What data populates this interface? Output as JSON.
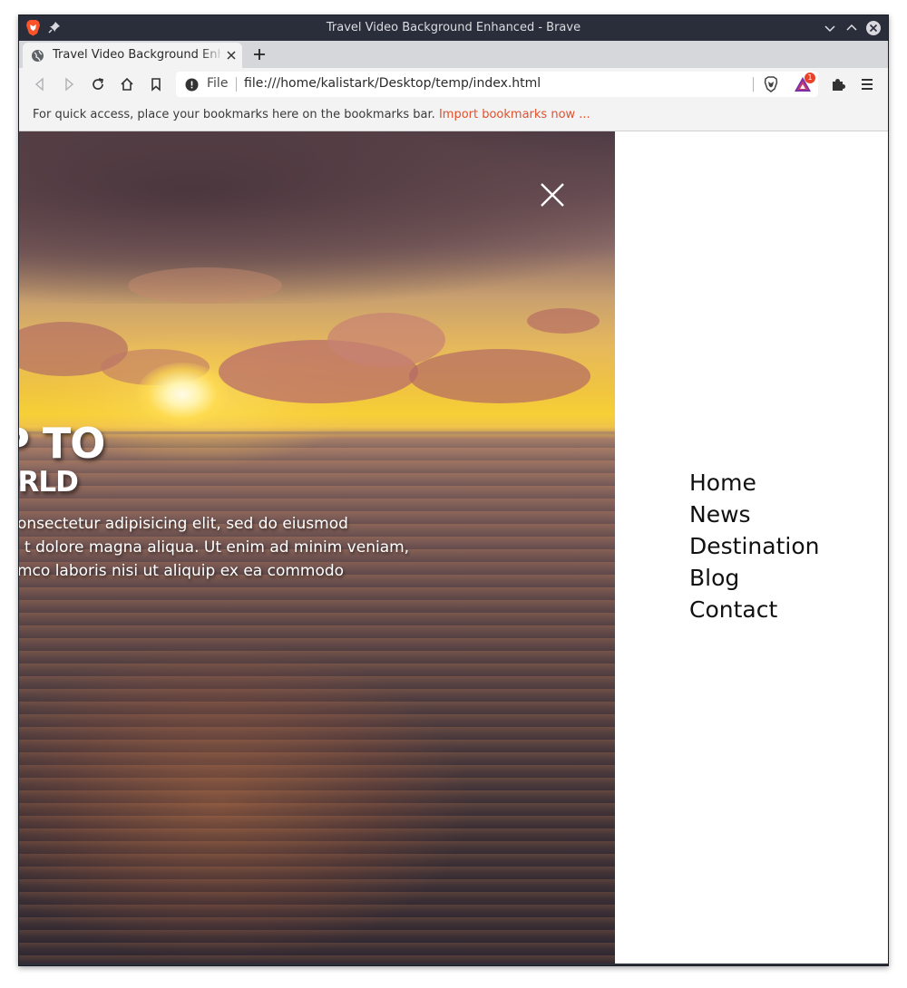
{
  "window": {
    "title": "Travel Video Background Enhanced - Brave"
  },
  "tab": {
    "title": "Travel Video Background Enhanced"
  },
  "address_bar": {
    "scheme_label": "File",
    "url": "file:///home/kalistark/Desktop/temp/index.html",
    "rewards_badge": "1"
  },
  "bookmarks_bar": {
    "message": "For quick access, place your bookmarks here on the bookmarks bar.",
    "import_link": "Import bookmarks now ..."
  },
  "hero": {
    "heading_line1": "OP TO",
    "heading_line2": "WORLD",
    "paragraph_lines": [
      "onsectetur adipisicing elit, sed do eiusmod",
      "t dolore magna aliqua. Ut enim ad minim veniam,",
      "mco laboris nisi ut aliquip ex ea commodo"
    ]
  },
  "nav": {
    "items": [
      "Home",
      "News",
      "Destination",
      "Blog",
      "Contact"
    ]
  },
  "colors": {
    "brave_orange": "#fb542b",
    "link_orange": "#e2502b",
    "titlebar": "#2a2d3a",
    "nav_text": "#111111"
  },
  "icons": [
    "brave-lion-icon",
    "pin-icon",
    "minimize-icon",
    "maximize-icon",
    "window-close-icon",
    "globe-icon",
    "tab-close-icon",
    "new-tab-icon",
    "back-icon",
    "forward-icon",
    "reload-icon",
    "home-icon",
    "bookmark-icon",
    "info-icon",
    "brave-shield-icon",
    "brave-rewards-icon",
    "extensions-icon",
    "menu-icon",
    "close-x-icon"
  ]
}
